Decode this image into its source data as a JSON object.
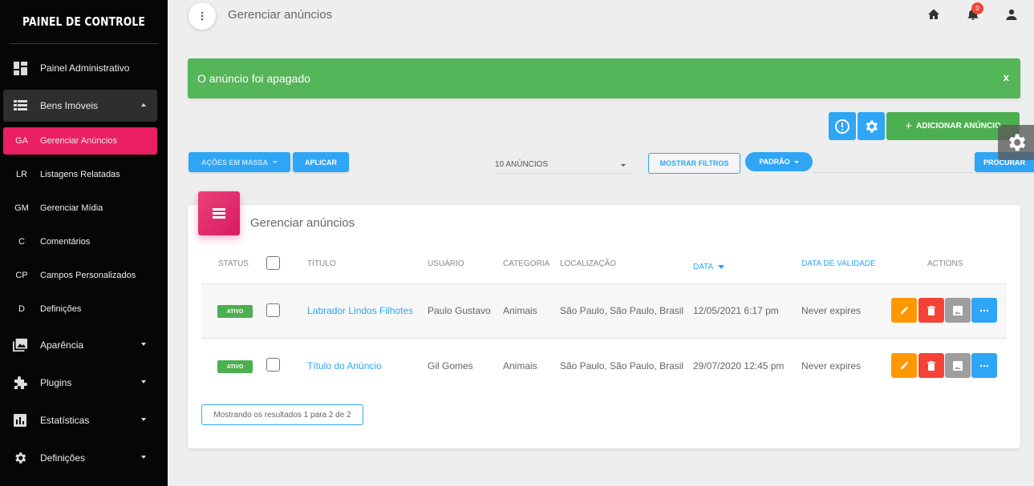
{
  "sidebar": {
    "brand": "PAINEL DE CONTROLE",
    "items": [
      {
        "label": "Painel Administrativo",
        "icon": "dashboard-icon"
      },
      {
        "label": "Bens Imóveis",
        "icon": "list-icon",
        "expanded": true
      },
      {
        "label": "Aparência",
        "icon": "photo-library-icon"
      },
      {
        "label": "Plugins",
        "icon": "puzzle-icon"
      },
      {
        "label": "Estatísticas",
        "icon": "bar-chart-icon"
      },
      {
        "label": "Definições",
        "icon": "gear-icon"
      }
    ],
    "subitems": [
      {
        "abbr": "GA",
        "label": "Gerenciar Anúncios",
        "active": true
      },
      {
        "abbr": "LR",
        "label": "Listagens Relatadas"
      },
      {
        "abbr": "GM",
        "label": "Gerenciar Mídia"
      },
      {
        "abbr": "C",
        "label": "Comentários"
      },
      {
        "abbr": "CP",
        "label": "Campos Personalizados"
      },
      {
        "abbr": "D",
        "label": "Definições"
      }
    ]
  },
  "header": {
    "title": "Gerenciar anúncios",
    "notification_count": "0"
  },
  "alert": {
    "message": "O anúncio foi apagado",
    "close": "x"
  },
  "toolbar": {
    "add_label": "ADICIONAR ANÚNCIO",
    "add_plus": "+",
    "bulk_actions": "AÇÕES EM MASSA",
    "apply": "APLICAR",
    "per_page": "10 ANÚNCIOS",
    "show_filters": "MOSTRAR FILTROS",
    "preset": "PADRÃO",
    "search": "PROCURAR",
    "search_value": ""
  },
  "table": {
    "title": "Gerenciar anúncios",
    "columns": {
      "status": "STATUS",
      "title": "TÍTULO",
      "user": "USUÁRIO",
      "category": "CATEGORIA",
      "location": "LOCALIZAÇÃO",
      "date": "DATA",
      "expiry": "DATA DE VALIDADE",
      "actions": "ACTIONS"
    },
    "rows": [
      {
        "status": "ATIVO",
        "title": "Labrador Lindos Filhotes",
        "user": "Paulo Gustavo",
        "category": "Animais",
        "location": "São Paulo, São Paulo, Brasil",
        "date": "12/05/2021 6:17 pm",
        "expiry": "Never expires"
      },
      {
        "status": "ATIVO",
        "title": "Título do Anúncio",
        "user": "Gil Gomes",
        "category": "Animais",
        "location": "São Paulo, São Paulo, Brasil",
        "date": "29/07/2020 12:45 pm",
        "expiry": "Never expires"
      }
    ],
    "footer": "Mostrando os resultados 1 para 2 de 2"
  },
  "colors": {
    "accent_pink": "#e91e63",
    "primary_blue": "#2ea6f5",
    "success_green": "#4caf50",
    "edit_orange": "#ff9800",
    "delete_red": "#f44336",
    "media_gray": "#9e9e9e"
  }
}
